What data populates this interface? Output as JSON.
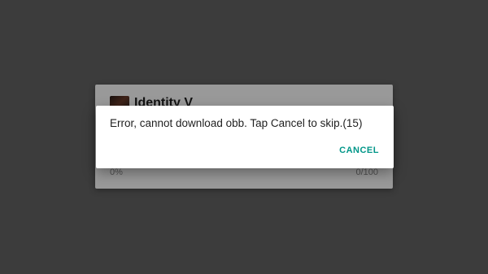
{
  "background_card": {
    "app_title": "Identity V",
    "progress_percent_label": "0%",
    "progress_count_label": "0/100",
    "icon": "app-icon-identity-v"
  },
  "dialog": {
    "message": "Error, cannot download obb. Tap Cancel to skip.(15)",
    "cancel_label": "CANCEL",
    "accent_color": "#009688"
  }
}
